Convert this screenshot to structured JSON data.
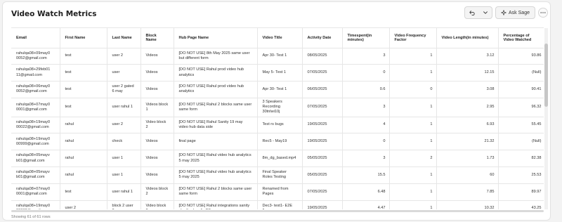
{
  "page": {
    "title": "Video Watch Metrics"
  },
  "toolbar": {
    "ask_label": "Ask Sage"
  },
  "table": {
    "columns": [
      "Email",
      "First Name",
      "Last Name",
      "Block Name",
      "Hub Page Name",
      "Video Title",
      "Activity Date",
      "Timespent(in minutes)",
      "Video Frequency Factor",
      "Video Length(in minutes)",
      "Percentage of Video Watched"
    ],
    "rows": [
      [
        "rahulqa08+09may0 0052@gmail.com",
        "test",
        "user 2",
        "Videos",
        "[DO NOT USE] 8th May 2025 same user but different form",
        "Apr 30- Test 1",
        "08/05/2025",
        "3",
        "1",
        "3.12",
        "93.86"
      ],
      [
        "rahulqa08+29feb01 11@gmail.com",
        "test",
        "user",
        "Videos",
        "[DO NOT USE] Rahul prod video hub analytics",
        "May 5- Test 1",
        "07/05/2025",
        "0",
        "1",
        "12.15",
        "(Null)"
      ],
      [
        "rahulqa08+06may0 0052@gmail.com",
        "test",
        "user 2 gated 6 may",
        "Videos",
        "[DO NOT USE] Rahul prod video hub analytics",
        "Apr 30- Test 1",
        "06/05/2025",
        "0.6",
        "0",
        "3.08",
        "90.41"
      ],
      [
        "rahulqa08+07may0 0001@gmail.com",
        "test",
        "user rahul 1",
        "Videos block 1",
        "[DO NOT USE] Rahul 2 blocks same user same form",
        "3 Speakers Recording 30tnlwi10j",
        "07/05/2025",
        "3",
        "1",
        "2.95",
        "96.32"
      ],
      [
        "rahulqa08+19may0 00022@gmail.com",
        "rahul",
        "user 2",
        "Video block 2",
        "[DO NOT USE] Rahul Sanity 19 may video hub data side",
        "Test rs bugs",
        "19/05/2025",
        "4",
        "1",
        "6.93",
        "55.45"
      ],
      [
        "rahulqa08+19may0 00999@gmail.com",
        "rahul",
        "check",
        "Videos",
        "final page",
        "Rec5 - May19",
        "19/05/2025",
        "0",
        "1",
        "21.32",
        "(Null)"
      ],
      [
        "rahulqa08+05mayv b01@gmail.com",
        "rahul",
        "user 1",
        "Videos",
        "[DO NOT USE] Rahul video hub analytics 5 may 2025",
        "8m_dg_based.mp4",
        "05/05/2025",
        "3",
        "2",
        "1.73",
        "82.38"
      ],
      [
        "rahulqa08+05mayv b01@gmail.com",
        "rahul",
        "user 1",
        "Videos",
        "[DO NOT USE] Rahul video hub analytics 5 may 2025",
        "Final Speaker Roles Testing",
        "05/05/2025",
        "15.5",
        "1",
        "60",
        "25.53"
      ],
      [
        "rahulqa08+07may0 0001@gmail.com",
        "test",
        "user rahul 1",
        "Videos block 2",
        "[DO NOT USE] Rahul 2 blocks same user same form",
        "Renamed from Pages",
        "07/05/2025",
        "6.48",
        "1",
        "7.85",
        "89.97"
      ],
      [
        "rahulqa08+19may0 00032@gmail.com",
        "user 2",
        "block 2 user 2",
        "Video block 2",
        "[DO NOT USE] Rahul integrations sanity vh after bug fix R2",
        "Dec3- test1- E2E flow",
        "19/05/2025",
        "4.47",
        "1",
        "10.32",
        "43.25"
      ]
    ]
  },
  "footer": {
    "rows_info": "Showing 61 of 61 rows"
  }
}
